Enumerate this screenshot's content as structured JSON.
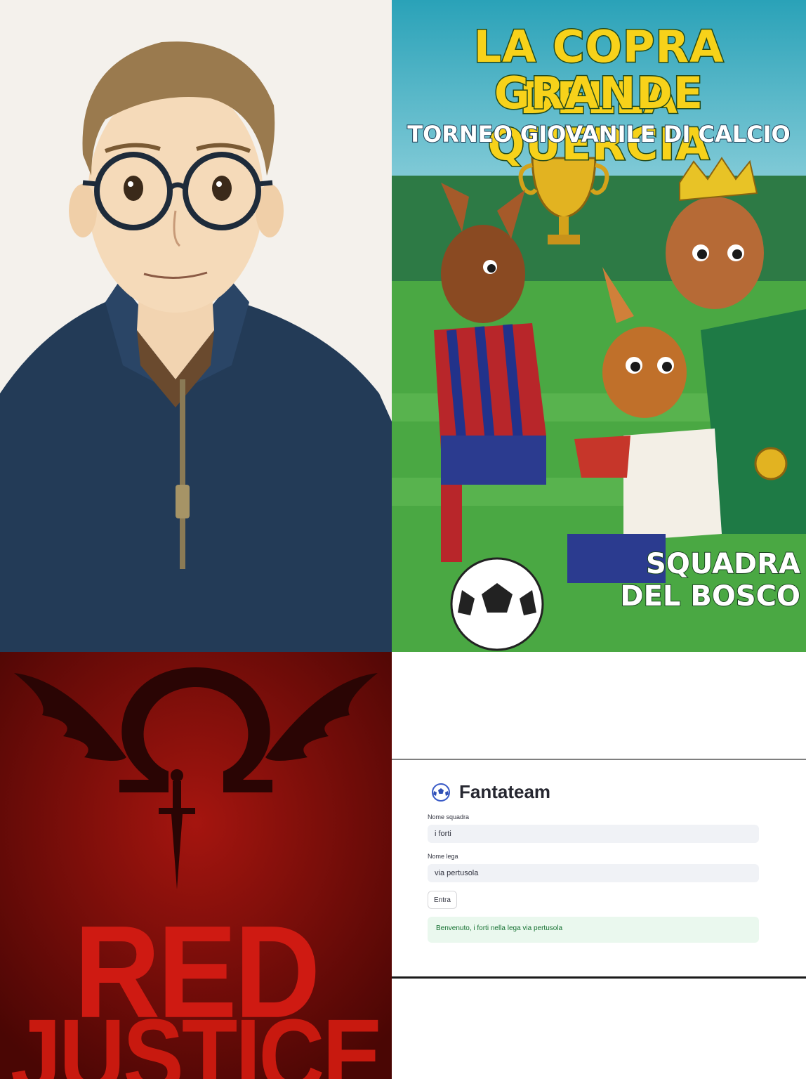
{
  "poster": {
    "title_line_1": "LA COPRA DELLA",
    "title_line_2": "GRANDE QUERCIA",
    "subtitle": "TORNEO GIOVANILE DI CALCIO",
    "team_line_1": "SQUADRA",
    "team_line_2": "DEL BOSCO",
    "colors": {
      "title": "#f7d21a",
      "sky": "#7fc8e6",
      "grass": "#3f9a3e"
    }
  },
  "red_justice": {
    "word_1": "RED",
    "word_2": "JUSTICE",
    "colors": {
      "background": "#7a0d0a",
      "text": "#cf1a12",
      "emblem": "#2a0504"
    }
  },
  "app": {
    "title": "Fantateam",
    "logo_icon": "soccer-ball-icon",
    "team_label": "Nome squadra",
    "team_value": "i forti",
    "league_label": "Nome lega",
    "league_value": "via pertusola",
    "submit_label": "Entra",
    "success_message": "Benvenuto, i forti nella lega via pertusola",
    "colors": {
      "input_bg": "#f0f2f6",
      "success_bg": "#eaf8ee",
      "success_text": "#177233"
    }
  }
}
